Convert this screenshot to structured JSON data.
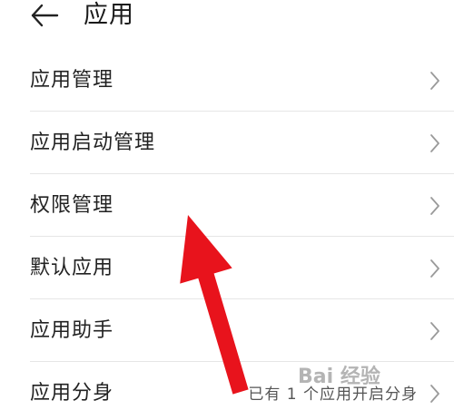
{
  "header": {
    "title": "应用",
    "back_icon": "arrow-left-icon"
  },
  "items": [
    {
      "label": "应用管理",
      "value": "",
      "icon": "chevron-right-icon"
    },
    {
      "label": "应用启动管理",
      "value": "",
      "icon": "chevron-right-icon"
    },
    {
      "label": "权限管理",
      "value": "",
      "icon": "chevron-right-icon"
    },
    {
      "label": "默认应用",
      "value": "",
      "icon": "chevron-right-icon"
    },
    {
      "label": "应用助手",
      "value": "",
      "icon": "chevron-right-icon"
    },
    {
      "label": "应用分身",
      "value": "已有 1 个应用开启分身",
      "icon": "chevron-right-icon"
    }
  ],
  "annotation": {
    "arrow_color": "#e8131c",
    "watermark": "Bai 经验"
  }
}
